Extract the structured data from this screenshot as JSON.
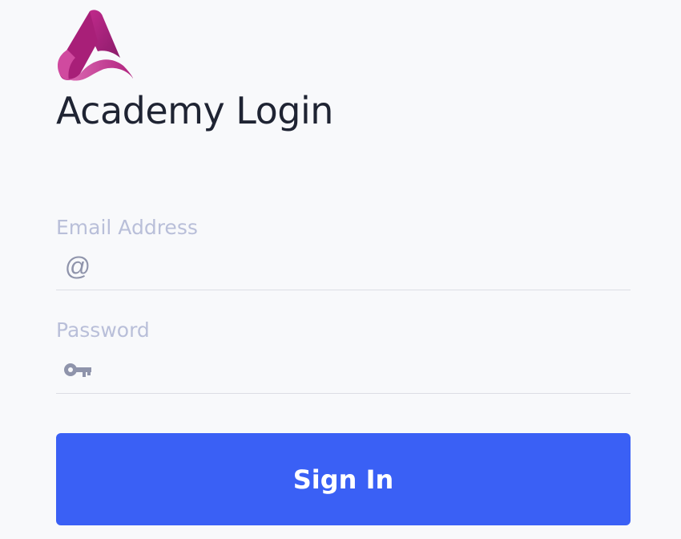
{
  "brand": {
    "logo_icon": "academy-a-logo",
    "colors": {
      "logo_primary": "#b0237e",
      "logo_secondary": "#d94fa8",
      "accent": "#3a60f5",
      "title_text": "#1f2433",
      "label_text": "#b9bfd9",
      "icon_color": "#8f94ab"
    }
  },
  "header": {
    "title": "Academy Login"
  },
  "form": {
    "email": {
      "label": "Email Address",
      "icon": "at-sign-icon",
      "icon_glyph": "@",
      "value": "",
      "placeholder": ""
    },
    "password": {
      "label": "Password",
      "icon": "key-icon",
      "value": "",
      "placeholder": ""
    },
    "submit_label": "Sign In"
  }
}
